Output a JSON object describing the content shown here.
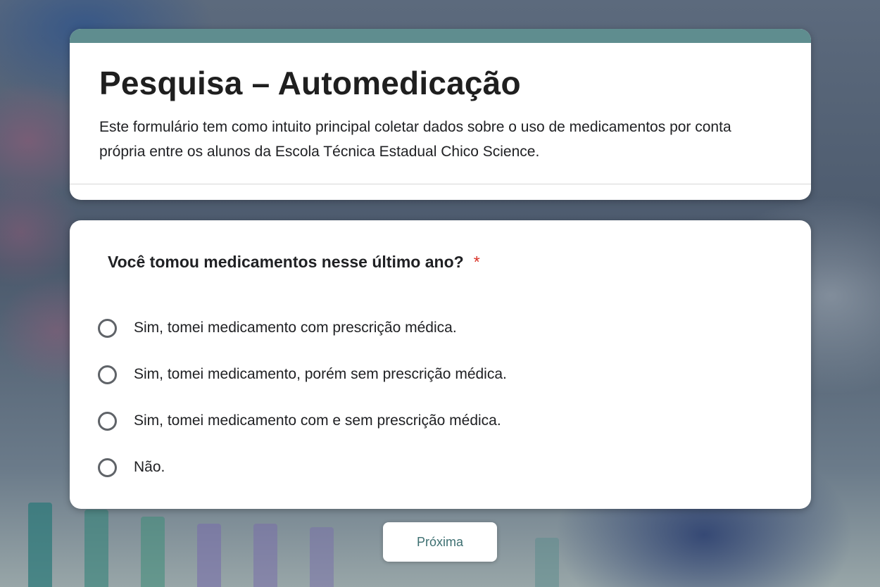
{
  "form": {
    "title": "Pesquisa – Automedicação",
    "description": "Este formulário tem como intuito principal coletar dados sobre o uso de medicamentos por conta própria entre os alunos da Escola Técnica Estadual Chico Science.",
    "accent_color": "#5f8d8f"
  },
  "question": {
    "title": "Você tomou medicamentos nesse último ano?",
    "required_marker": "*",
    "options": [
      "Sim, tomei medicamento com prescrição médica.",
      "Sim, tomei medicamento, porém sem prescrição médica.",
      "Sim, tomei medicamento com e sem prescrição médica.",
      "Não."
    ]
  },
  "navigation": {
    "next_label": "Próxima"
  }
}
